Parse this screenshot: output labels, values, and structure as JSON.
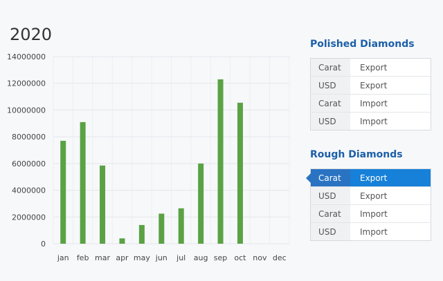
{
  "year": "2020",
  "chart_data": {
    "type": "bar",
    "categories": [
      "jan",
      "feb",
      "mar",
      "apr",
      "may",
      "jun",
      "jul",
      "aug",
      "sep",
      "oct",
      "nov",
      "dec"
    ],
    "values": [
      7700000,
      9100000,
      5850000,
      400000,
      1400000,
      2250000,
      2650000,
      6000000,
      12300000,
      10550000,
      null,
      null
    ],
    "yticks": [
      0,
      2000000,
      4000000,
      6000000,
      8000000,
      10000000,
      12000000,
      14000000
    ],
    "ytick_labels": [
      "0",
      "2000000",
      "4000000",
      "6000000",
      "8000000",
      "10000000",
      "12000000",
      "14000000"
    ],
    "ylim": [
      0,
      14000000
    ],
    "bar_color": "#5aa244",
    "grid": true
  },
  "polished": {
    "title": "Polished Diamonds",
    "rows": [
      {
        "unit": "Carat",
        "type": "Export",
        "active": false
      },
      {
        "unit": "USD",
        "type": "Export",
        "active": false
      },
      {
        "unit": "Carat",
        "type": "Import",
        "active": false
      },
      {
        "unit": "USD",
        "type": "Import",
        "active": false
      }
    ]
  },
  "rough": {
    "title": "Rough Diamonds",
    "rows": [
      {
        "unit": "Carat",
        "type": "Export",
        "active": true
      },
      {
        "unit": "USD",
        "type": "Export",
        "active": false
      },
      {
        "unit": "Carat",
        "type": "Import",
        "active": false
      },
      {
        "unit": "USD",
        "type": "Import",
        "active": false
      }
    ]
  },
  "colors": {
    "accent": "#1780d8",
    "title": "#1c5fa8",
    "bar": "#5aa244"
  }
}
